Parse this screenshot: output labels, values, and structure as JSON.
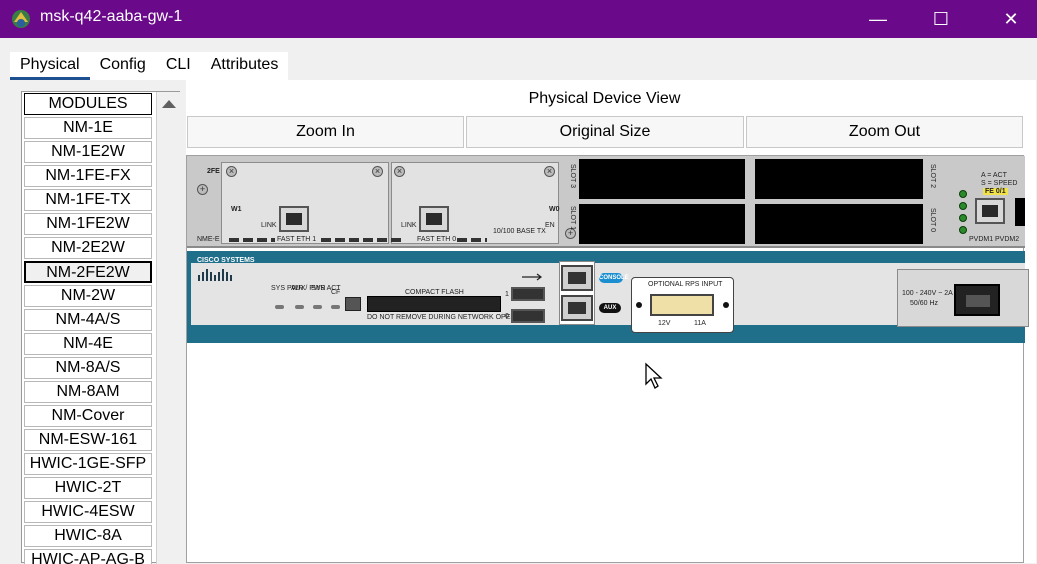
{
  "window": {
    "title": "msk-q42-aaba-gw-1",
    "minimize_glyph": "—",
    "maximize_glyph": "☐",
    "close_glyph": "✕"
  },
  "tabs": [
    "Physical",
    "Config",
    "CLI",
    "Attributes"
  ],
  "active_tab": "Physical",
  "modules": {
    "header": "MODULES",
    "items": [
      "NM-1E",
      "NM-1E2W",
      "NM-1FE-FX",
      "NM-1FE-TX",
      "NM-1FE2W",
      "NM-2E2W",
      "NM-2FE2W",
      "NM-2W",
      "NM-4A/S",
      "NM-4E",
      "NM-8A/S",
      "NM-8AM",
      "NM-Cover",
      "NM-ESW-161",
      "HWIC-1GE-SFP",
      "HWIC-2T",
      "HWIC-4ESW",
      "HWIC-8A",
      "HWIC-AP-AG-B"
    ],
    "selected": "NM-2FE2W"
  },
  "physical_view": {
    "title": "Physical Device View",
    "zoom_in": "Zoom In",
    "original_size": "Original Size",
    "zoom_out": "Zoom Out"
  },
  "device_labels": {
    "slot_label_1": "2FE 2W",
    "w1": "W1",
    "w0": "W0",
    "link1": "LINK",
    "link2": "LINK",
    "fast_eth1": "FAST ETH 1",
    "fast_eth0": "FAST ETH 0",
    "base_tx": "10/100 BASE TX",
    "en": "EN",
    "nme": "NME-E",
    "slot2": "SLOT 2",
    "slot0": "SLOT 0",
    "slot3": "SLOT 3",
    "slot1": "SLOT 1",
    "act_legend_1": "A = ACT",
    "act_legend_2": "S = SPEED",
    "fe01": "FE 0/1",
    "pvdm1": "PVDM1",
    "pvdm2": "PVDM2",
    "brand": "CISCO SYSTEMS",
    "sys_pwr": "SYS PWR",
    "aux_pwr": "AUX/ PWR",
    "sys_act": "SYS ACT",
    "cf": "CF",
    "compact_flash": "COMPACT FLASH",
    "cf_warning": "DO NOT REMOVE DURING NETWORK OPERATION",
    "usb1": "1",
    "usb0": "0",
    "console": "CONSOLE",
    "aux": "AUX",
    "rps_title": "OPTIONAL RPS INPUT",
    "rps_12v": "12V",
    "rps_11a": "11A",
    "power_rating_1": "100 - 240V ~ 2A",
    "power_rating_2": "50/60 Hz"
  }
}
